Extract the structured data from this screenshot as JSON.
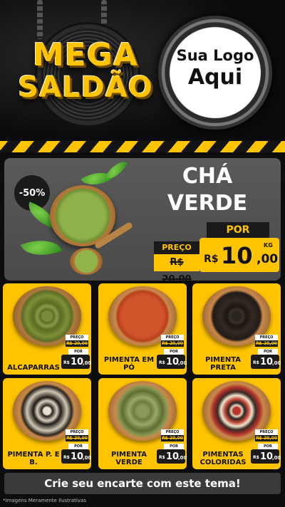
{
  "header": {
    "title_line1": "MEGA",
    "title_line2": "SALDÃO",
    "logo_line1": "Sua Logo",
    "logo_line2": "Aqui"
  },
  "hero": {
    "discount": "-50%",
    "title_line1": "CHÁ",
    "title_line2": "VERDE",
    "preco_label": "PREÇO",
    "old_price": "R$ 20,00",
    "por_label": "POR",
    "currency": "R$",
    "price_int": "10",
    "price_dec": ",00",
    "unit": "KG"
  },
  "products": [
    {
      "name": "ALCAPARRAS",
      "preco_label": "PREÇO",
      "old_price": "R$ 20,00",
      "por_label": "POR",
      "currency": "R$",
      "price_int": "10",
      "price_dec": ",00"
    },
    {
      "name": "PIMENTA EM PÓ",
      "preco_label": "PREÇO",
      "old_price": "R$ 20,00",
      "por_label": "POR",
      "currency": "R$",
      "price_int": "10",
      "price_dec": ",00"
    },
    {
      "name": "PIMENTA PRETA",
      "preco_label": "PREÇO",
      "old_price": "R$ 20,00",
      "por_label": "POR",
      "currency": "R$",
      "price_int": "10",
      "price_dec": ",00"
    },
    {
      "name": "PIMENTA P. E B.",
      "preco_label": "PREÇO",
      "old_price": "R$ 20,00",
      "por_label": "POR",
      "currency": "R$",
      "price_int": "10",
      "price_dec": ",00"
    },
    {
      "name": "PIMENTA VERDE",
      "preco_label": "PREÇO",
      "old_price": "R$ 20,00",
      "por_label": "POR",
      "currency": "R$",
      "price_int": "10",
      "price_dec": ",00"
    },
    {
      "name": "PIMENTAS COLORIDAS",
      "preco_label": "PREÇO",
      "old_price": "R$ 20,00",
      "por_label": "POR",
      "currency": "R$",
      "price_int": "10",
      "price_dec": ",00"
    }
  ],
  "footer": {
    "cta": "Crie seu encarte com este tema!",
    "disclaimer": "*Imagens Meramente Ilustrativas"
  },
  "colors": {
    "accent": "#ffc400",
    "dark": "#1a1a1a",
    "hero_panel": "#4f4f4f"
  },
  "icons": [
    "chain-decoration",
    "speaker-decoration",
    "tea-leaf-icon",
    "spice-bowl-icon"
  ]
}
